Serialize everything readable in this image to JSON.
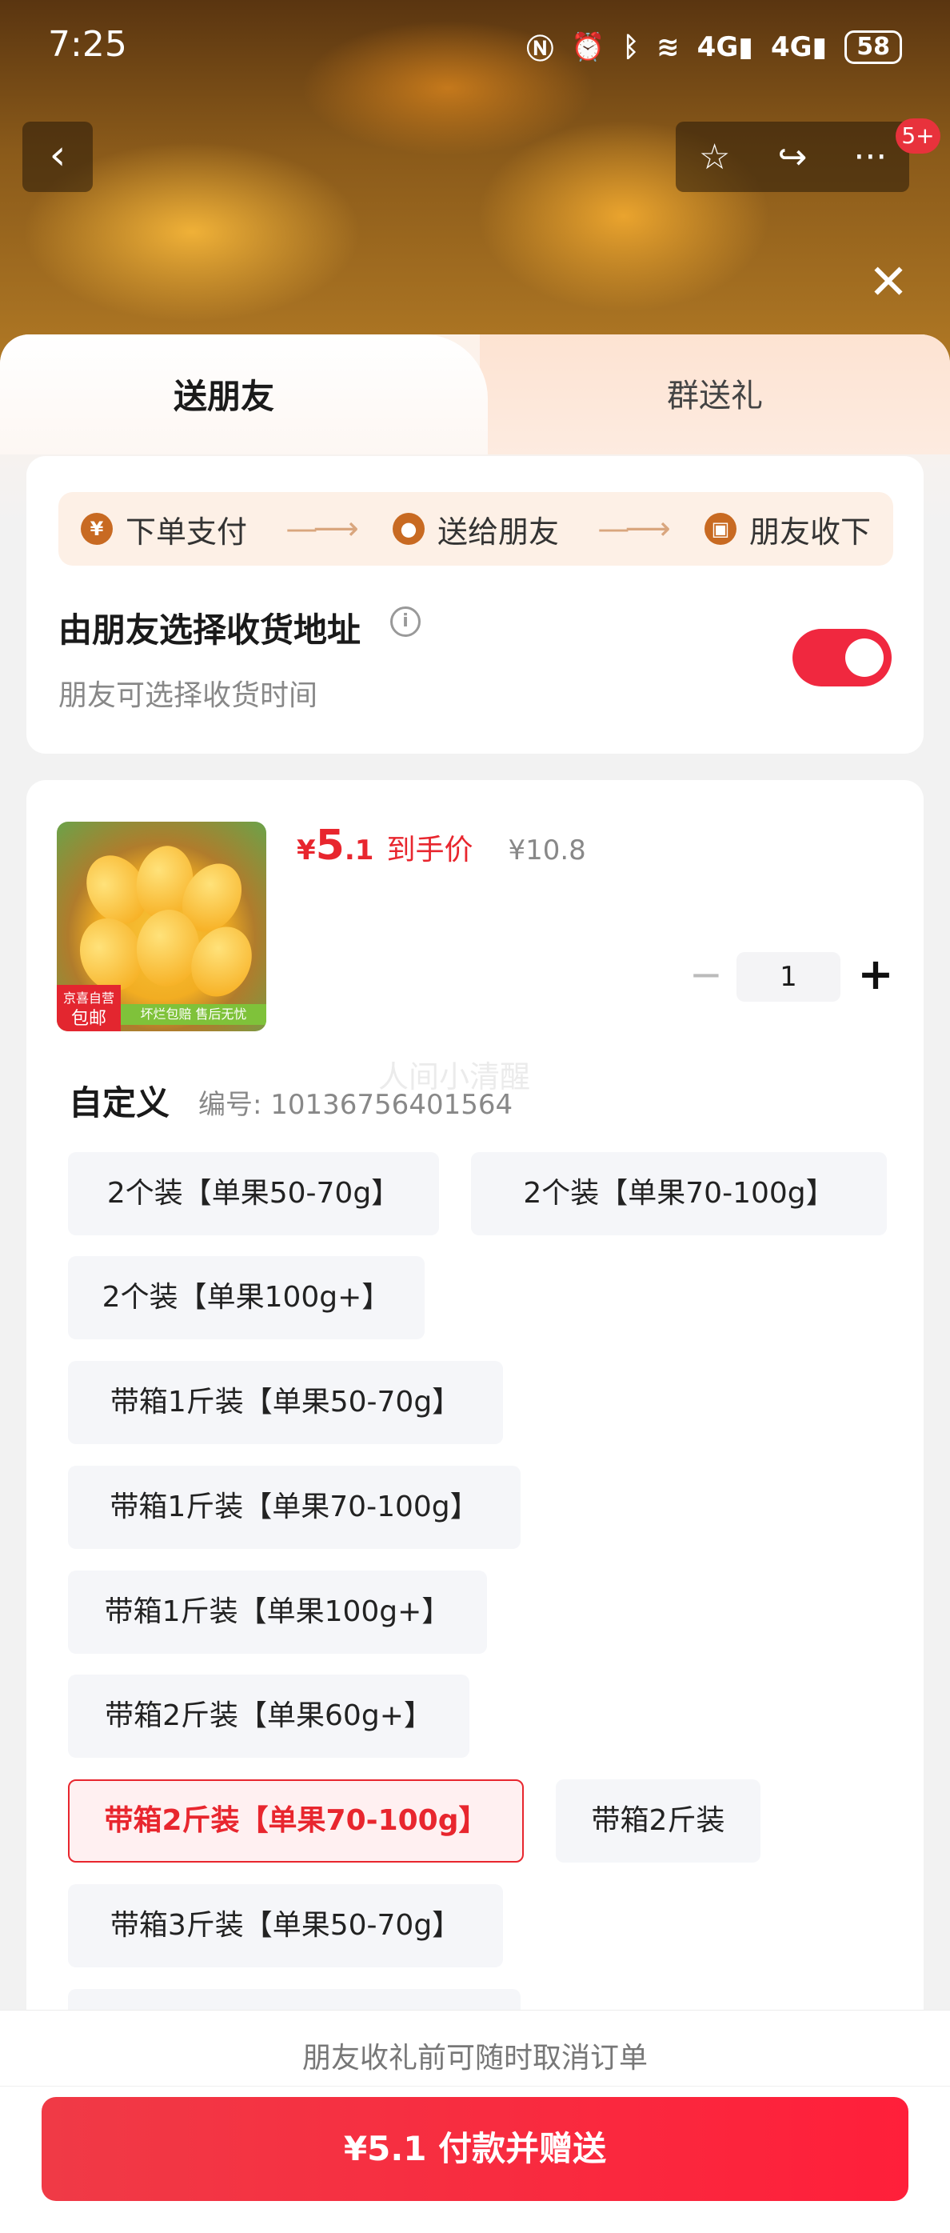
{
  "status_bar": {
    "time": "7:25",
    "icons": [
      "nfc-icon",
      "alarm-icon",
      "bluetooth-icon",
      "wifi-icon",
      "signal-4g-icon",
      "signal-4g-icon"
    ],
    "signal1": "4G",
    "signal2": "4G",
    "battery": "58"
  },
  "top_nav": {
    "badge": "5+",
    "icons": [
      "back-icon",
      "star-icon",
      "share-icon",
      "more-icon",
      "close-icon"
    ]
  },
  "tabs": [
    {
      "label": "送朋友",
      "active": true
    },
    {
      "label": "群送礼",
      "active": false
    }
  ],
  "steps": [
    {
      "icon": "yen-icon",
      "label": "下单支付"
    },
    {
      "icon": "wechat-icon",
      "label": "送给朋友"
    },
    {
      "icon": "gift-icon",
      "label": "朋友收下"
    }
  ],
  "address": {
    "title": "由朋友选择收货地址",
    "subtitle": "朋友可选择收货时间",
    "toggle_on": true
  },
  "product": {
    "thumb_tag_line1": "京喜自营",
    "thumb_tag_line2": "包邮",
    "thumb_strip": "坏烂包赔 售后无忧",
    "price_symbol": "¥",
    "price_int": "5",
    "price_dec": ".1",
    "price_label": "到手价",
    "original_price": "¥10.8",
    "quantity": "1",
    "minus": "−",
    "plus": "+"
  },
  "spec": {
    "title": "自定义",
    "code": "编号: 10136756401564",
    "watermark": "人间小清醒",
    "options": [
      {
        "label": "2个装【单果50-70g】",
        "selected": false
      },
      {
        "label": "2个装【单果70-100g】",
        "selected": false
      },
      {
        "label": "2个装【单果100g+】",
        "selected": false
      },
      {
        "label": "带箱1斤装【单果50-70g】",
        "selected": false
      },
      {
        "label": "带箱1斤装【单果70-100g】",
        "selected": false
      },
      {
        "label": "带箱1斤装【单果100g+】",
        "selected": false
      },
      {
        "label": "带箱2斤装【单果60g+】",
        "selected": false
      },
      {
        "label": "带箱2斤装【单果70-100g】",
        "selected": true
      },
      {
        "label": "带箱2斤装",
        "selected": false
      },
      {
        "label": "带箱3斤装【单果50-70g】",
        "selected": false
      }
    ]
  },
  "footer": {
    "note": "朋友收礼前可随时取消订单",
    "pay_button": "¥5.1 付款并赠送"
  },
  "colors": {
    "accent": "#e8262e",
    "toggle": "#f0283f",
    "selected_bg": "#fff0f1",
    "step_bg": "#fdf0e6"
  }
}
